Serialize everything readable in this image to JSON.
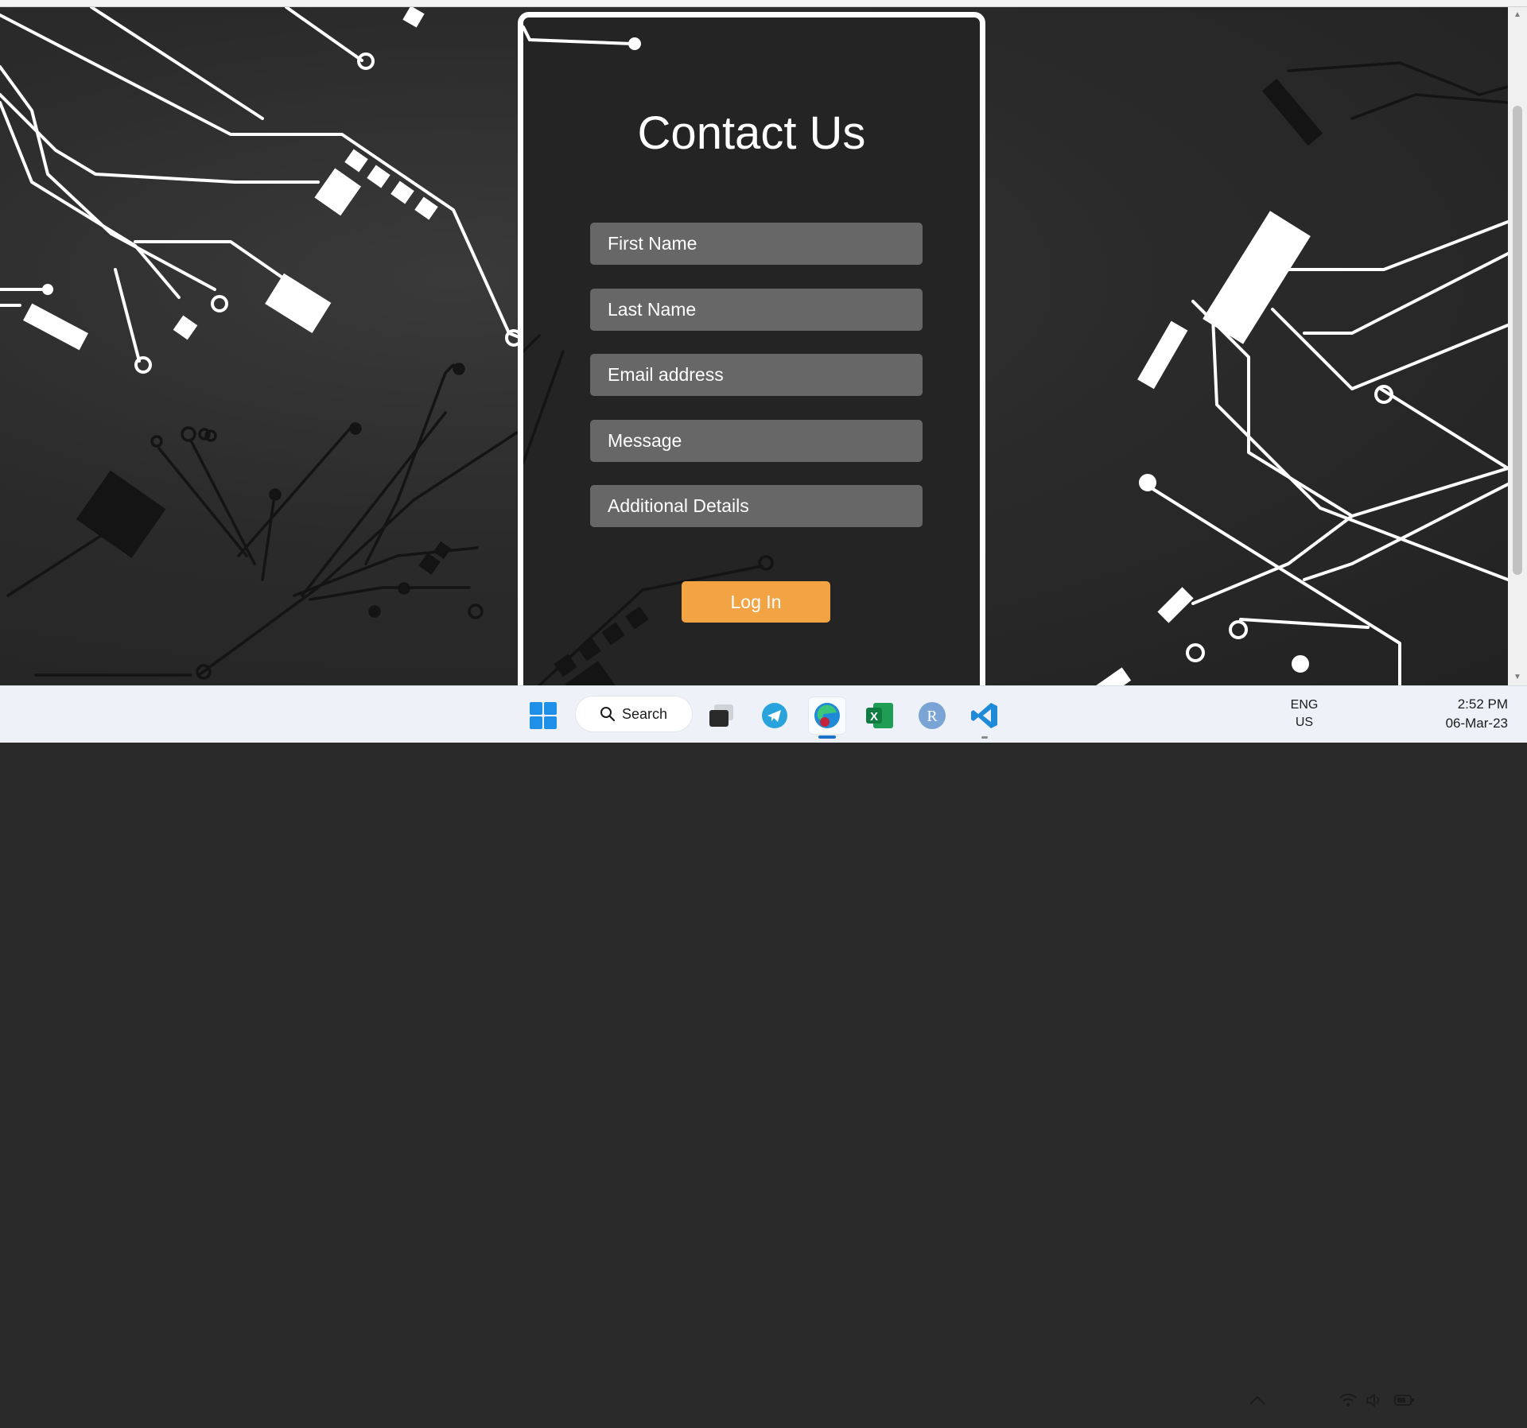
{
  "contact_form": {
    "title": "Contact Us",
    "fields": [
      {
        "placeholder": "First Name"
      },
      {
        "placeholder": "Last Name"
      },
      {
        "placeholder": "Email address"
      },
      {
        "placeholder": "Message"
      },
      {
        "placeholder": "Additional Details"
      }
    ],
    "submit_label": "Log In",
    "submit_color": "#f2a444",
    "field_color": "#676767"
  },
  "taskbar": {
    "search_label": "Search",
    "apps": [
      "start-icon",
      "task-view-icon",
      "telegram-icon",
      "edge-icon",
      "excel-icon",
      "r-icon",
      "vscode-icon"
    ],
    "active_app": "edge-icon",
    "language": "ENG",
    "region": "US",
    "time": "2:52 PM",
    "date": "06-Mar-23"
  }
}
